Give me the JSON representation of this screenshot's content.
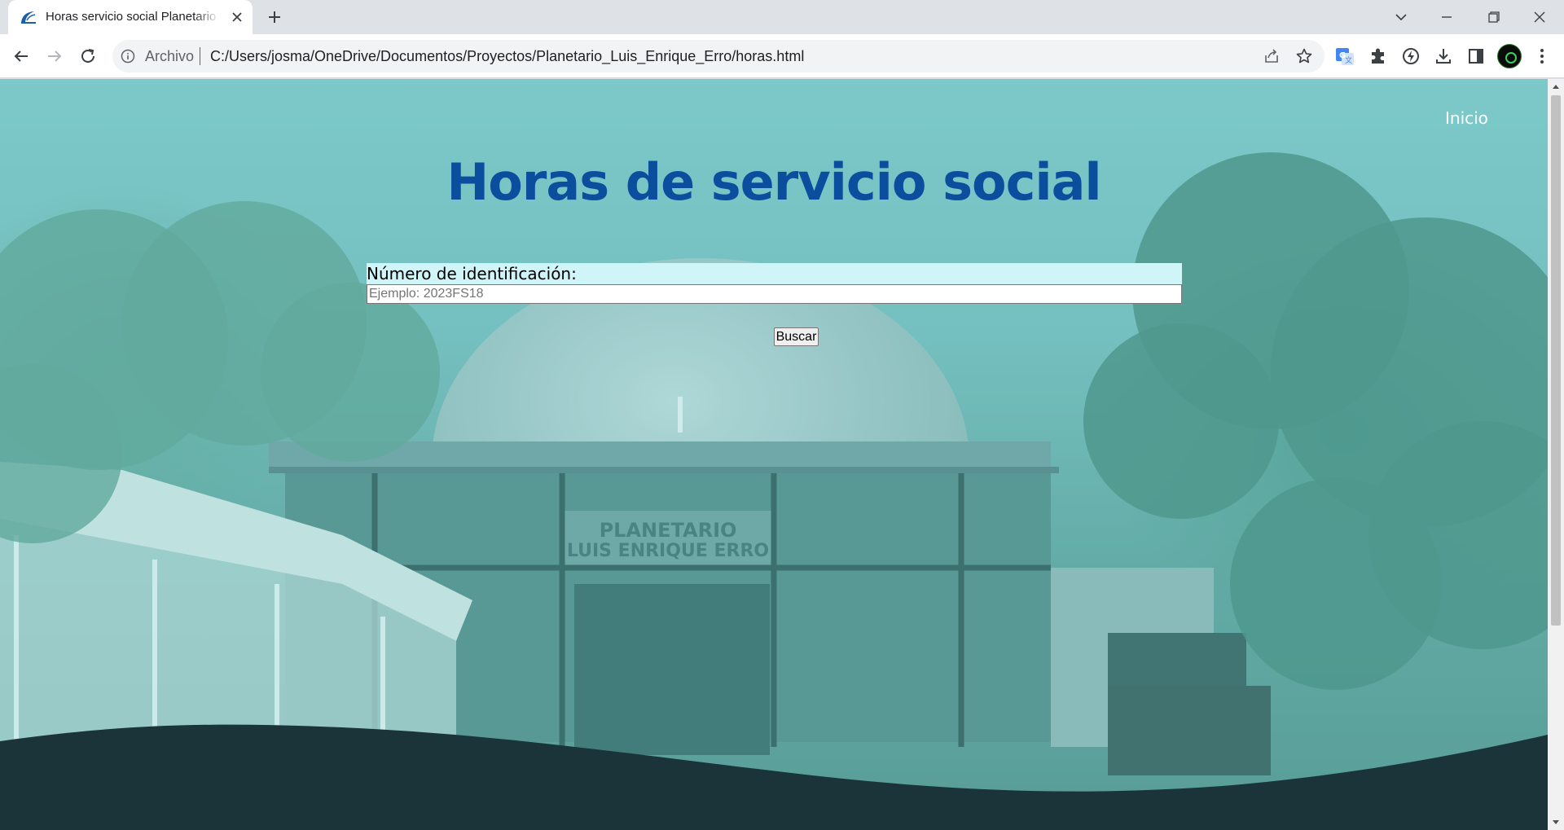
{
  "browser": {
    "tab": {
      "title": "Horas servicio social Planetario Luis Enrique Erro",
      "favicon": "planetarium-logo-icon",
      "close_icon": "close-icon"
    },
    "new_tab_icon": "plus-icon",
    "window_controls": [
      "tab-search-chevron-icon",
      "minimize-icon",
      "restore-icon",
      "close-window-icon"
    ],
    "nav": [
      "back-arrow-icon",
      "forward-arrow-icon",
      "reload-icon"
    ],
    "address_bar": {
      "scheme_label": "Archivo",
      "url": "C:/Users/josma/OneDrive/Documentos/Proyectos/Planetario_Luis_Enrique_Erro/horas.html"
    },
    "toolbar_icons": [
      "share-icon",
      "bookmark-star-icon",
      "google-translate-icon",
      "extensions-puzzle-icon",
      "performance-icon",
      "download-icon",
      "side-panel-icon",
      "profile-avatar",
      "kebab-menu-icon"
    ]
  },
  "page": {
    "nav_link": "Inicio",
    "title": "Horas de servicio social",
    "form": {
      "label": "Número de identificación:",
      "placeholder": "Ejemplo: 2023FS18",
      "value": "",
      "button_label": "Buscar"
    },
    "background_sign_line1": "PLANETARIO",
    "background_sign_line2": "LUIS ENRIQUE ERRO"
  },
  "colors": {
    "title": "#0b4e9e",
    "label_bg": "#cff5f9",
    "wave_footer": "#1a3439",
    "background_tint": "#7fc8c8"
  }
}
